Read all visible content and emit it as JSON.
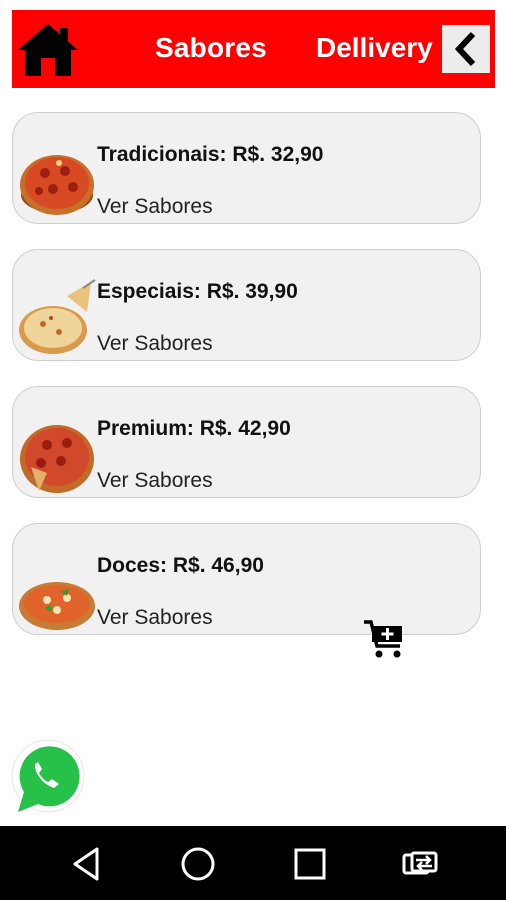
{
  "header": {
    "title": "Sabores",
    "delivery_label": "Dellivery",
    "background_color": "#ff0000",
    "home_icon": "home-icon",
    "back_icon": "chevron-left-icon"
  },
  "categories": [
    {
      "title": "Tradicionais: R$. 32,90",
      "link": "Ver Sabores"
    },
    {
      "title": "Especiais: R$. 39,90",
      "link": "Ver Sabores"
    },
    {
      "title": "Premium: R$. 42,90",
      "link": "Ver Sabores"
    },
    {
      "title": "Doces: R$. 46,90",
      "link": "Ver Sabores"
    }
  ],
  "actions": {
    "cart_icon": "add-to-cart-icon",
    "whatsapp_icon": "whatsapp-icon"
  },
  "navbar": {
    "items": [
      "back-triangle-icon",
      "home-circle-icon",
      "recent-apps-square-icon",
      "switch-app-icon"
    ]
  }
}
